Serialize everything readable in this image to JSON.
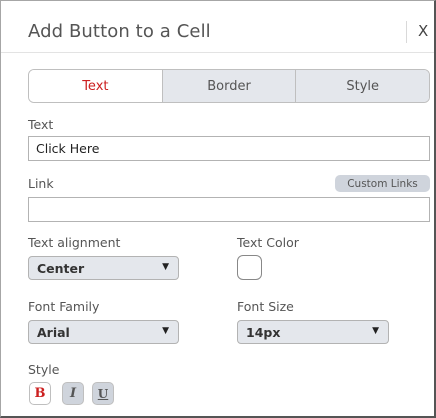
{
  "dialog": {
    "title": "Add Button to a Cell",
    "close_label": "X"
  },
  "tabs": [
    {
      "label": "Text",
      "active": true
    },
    {
      "label": "Border",
      "active": false
    },
    {
      "label": "Style",
      "active": false
    }
  ],
  "text_field": {
    "label": "Text",
    "value": "Click Here"
  },
  "link_field": {
    "label": "Link",
    "value": "",
    "custom_links_label": "Custom Links"
  },
  "text_alignment": {
    "label": "Text alignment",
    "selected": "Center"
  },
  "text_color": {
    "label": "Text Color",
    "value": "#ffffff"
  },
  "font_family": {
    "label": "Font Family",
    "selected": "Arial"
  },
  "font_size": {
    "label": "Font Size",
    "selected": "14px"
  },
  "style": {
    "label": "Style",
    "bold_label": "B",
    "italic_label": "I",
    "underline_label": "U",
    "bold_active": true,
    "italic_active": false,
    "underline_active": false
  },
  "colors": {
    "accent": "#cc1f1f",
    "inactive_tab": "#e4e7ec"
  }
}
